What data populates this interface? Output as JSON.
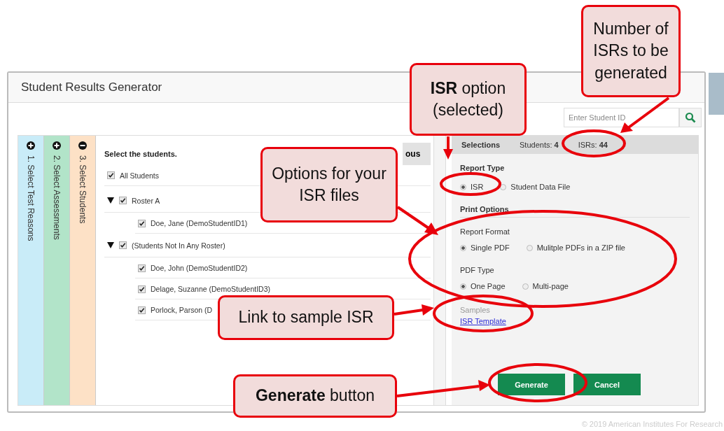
{
  "window": {
    "title": "Student Results Generator"
  },
  "search": {
    "placeholder": "Enter Student ID"
  },
  "steps": [
    {
      "label": "1. Select Test Reasons",
      "color": "#c9ecf8",
      "expanded": false
    },
    {
      "label": "2. Select Assessments",
      "color": "#b2e4c9",
      "expanded": false
    },
    {
      "label": "3. Select Students",
      "color": "#fde1c6",
      "expanded": true
    }
  ],
  "students": {
    "heading": "Select the students.",
    "button": "ous",
    "all": {
      "label": "All Students",
      "checked": true
    },
    "groups": [
      {
        "label": "Roster A",
        "checked": true,
        "expanded": true,
        "children": [
          {
            "label": "Doe, Jane (DemoStudentID1)",
            "checked": true
          }
        ]
      },
      {
        "label": "(Students Not In Any Roster)",
        "checked": true,
        "expanded": true,
        "children": [
          {
            "label": "Doe, John (DemoStudentID2)",
            "checked": true
          },
          {
            "label": "Delage, Suzanne (DemoStudentID3)",
            "checked": true
          },
          {
            "label": "Porlock, Parson (D",
            "checked": true
          }
        ]
      }
    ]
  },
  "selections": {
    "title": "Selections",
    "students": "Students: **4**",
    "isrs": "ISRs: **44**"
  },
  "report_type": {
    "title": "Report Type",
    "options": [
      {
        "label": "ISR",
        "selected": true
      },
      {
        "label": "Student Data File",
        "selected": false
      }
    ]
  },
  "print_options": {
    "title": "Print Options",
    "groups": [
      {
        "title": "Report Format",
        "options": [
          {
            "label": "Single PDF",
            "selected": true
          },
          {
            "label": "Mulitple PDFs in a ZIP file",
            "selected": false
          }
        ]
      },
      {
        "title": "PDF Type",
        "options": [
          {
            "label": "One Page",
            "selected": true
          },
          {
            "label": "Multi-page",
            "selected": false
          }
        ]
      }
    ]
  },
  "samples": {
    "title": "Samples",
    "link": "ISR Template"
  },
  "actions": [
    {
      "label": "Generate"
    },
    {
      "label": "Cancel"
    }
  ],
  "footer": "© 2019 American Institutes For Research",
  "callouts": [
    {
      "text": "Number of ISRs to be generated"
    },
    {
      "text": "**ISR** option (selected)"
    },
    {
      "text": "Options for your ISR files"
    },
    {
      "text": "Link to sample ISR"
    },
    {
      "text": "**Generate** button"
    }
  ]
}
